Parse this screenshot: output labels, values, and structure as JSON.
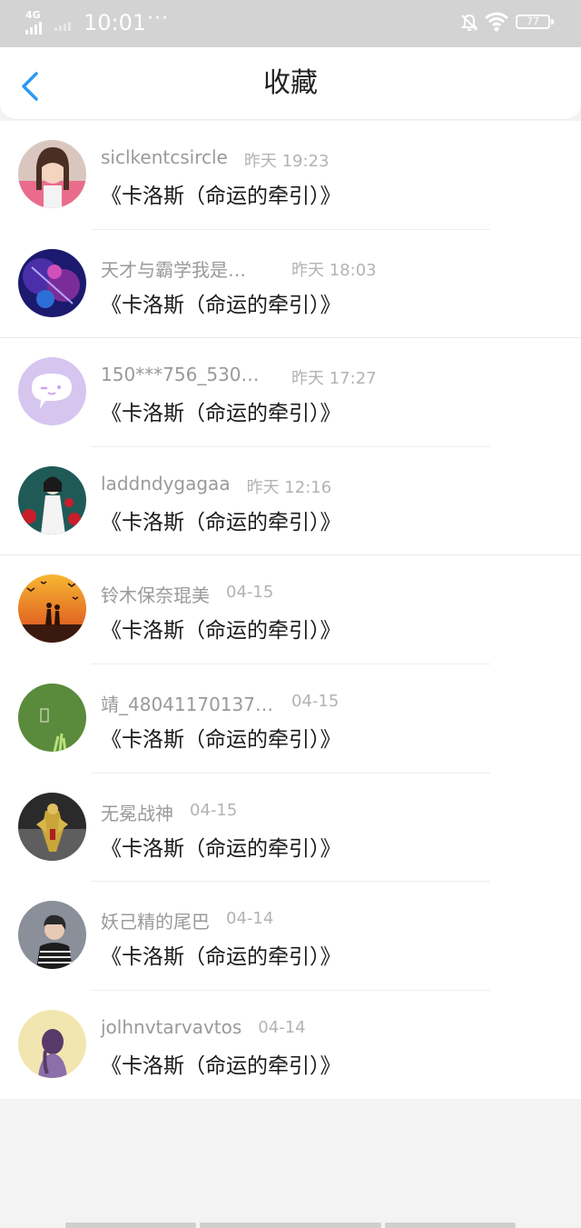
{
  "status_bar": {
    "network": "4G",
    "time": "10:01",
    "more": "···",
    "battery": "77"
  },
  "header": {
    "title": "收藏",
    "back_icon": "chevron-left-icon",
    "accent_color": "#2b9af3"
  },
  "items": [
    {
      "name": "siclkentcsircle",
      "time": "昨天 19:23",
      "book": "《卡洛斯（命运的牵引）》",
      "avatar": "woman-photo"
    },
    {
      "name": "天才与霸学我是…",
      "time": "昨天 18:03",
      "book": "《卡洛斯（命运的牵引）》",
      "avatar": "purple-fantasy"
    },
    {
      "name": "150***756_530…",
      "time": "昨天 17:27",
      "book": "《卡洛斯（命运的牵引）》",
      "avatar": "default-chat-bubble"
    },
    {
      "name": "laddndygagaa",
      "time": "昨天 12:16",
      "book": "《卡洛斯（命运的牵引）》",
      "avatar": "girl-illustration"
    },
    {
      "name": "铃木保奈琨美",
      "time": "04-15",
      "book": "《卡洛斯（命运的牵引）》",
      "avatar": "sunset-couple"
    },
    {
      "name": "靖_48041170137…",
      "time": "04-15",
      "book": "《卡洛斯（命运的牵引）》",
      "avatar": "green-plant"
    },
    {
      "name": "无冕战神",
      "time": "04-15",
      "book": "《卡洛斯（命运的牵引）》",
      "avatar": "armored-warrior"
    },
    {
      "name": "妖己精的尾巴",
      "time": "04-14",
      "book": "《卡洛斯（命运的牵引）》",
      "avatar": "boy-striped-shirt"
    },
    {
      "name": "jolhnvtarvavtos",
      "time": "04-14",
      "book": "《卡洛斯（命运的牵引）》",
      "avatar": "girl-back-view"
    }
  ]
}
